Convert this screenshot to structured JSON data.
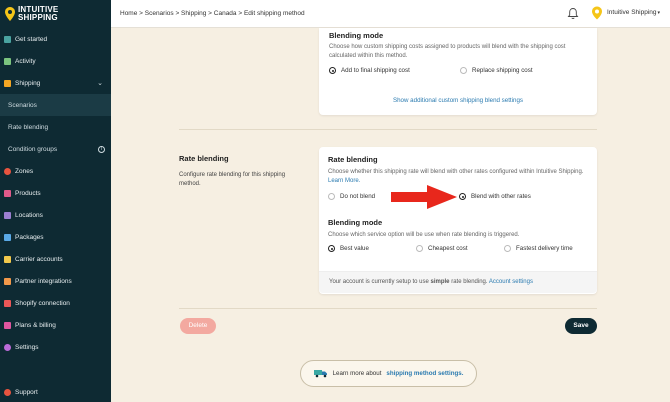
{
  "app": {
    "logo_line1": "INTUITIVE",
    "logo_line2": "SHIPPING"
  },
  "colors": {
    "sidebar_bg": "#0e2a33",
    "page_bg": "#f6efe2",
    "link": "#2b7bb0",
    "delete": "#f3a9a0",
    "arrow": "#e8271c"
  },
  "sidebar": {
    "items": [
      {
        "label": "Get started",
        "icon": "rocket-icon"
      },
      {
        "label": "Activity",
        "icon": "chart-icon"
      },
      {
        "label": "Shipping",
        "icon": "shipping-icon"
      },
      {
        "label": "Scenarios",
        "icon": ""
      },
      {
        "label": "Rate blending",
        "icon": ""
      },
      {
        "label": "Condition groups",
        "icon": ""
      },
      {
        "label": "Zones",
        "icon": "globe-icon"
      },
      {
        "label": "Products",
        "icon": "tag-icon"
      },
      {
        "label": "Locations",
        "icon": "building-icon"
      },
      {
        "label": "Packages",
        "icon": "box-icon"
      },
      {
        "label": "Carrier accounts",
        "icon": "key-icon"
      },
      {
        "label": "Partner integrations",
        "icon": "integration-icon"
      },
      {
        "label": "Shopify connection",
        "icon": "shopify-icon"
      },
      {
        "label": "Plans & billing",
        "icon": "billing-icon"
      },
      {
        "label": "Settings",
        "icon": "gear-icon"
      }
    ],
    "support": "Support"
  },
  "topbar": {
    "breadcrumb": "Home > Scenarios > Shipping > Canada > Edit shipping method",
    "account": "Intuitive Shipping"
  },
  "card1": {
    "title": "Blending mode",
    "desc": "Choose how custom shipping costs assigned to products will blend with the shipping cost calculated within this method.",
    "options": [
      "Add to final shipping cost",
      "Replace shipping cost"
    ],
    "selected": "Add to final shipping cost",
    "link": "Show additional custom shipping blend settings"
  },
  "section": {
    "title": "Rate blending",
    "desc": "Configure rate blending for this shipping method."
  },
  "card2": {
    "title": "Rate blending",
    "desc": "Choose whether this shipping rate will blend with other rates configured within Intuitive Shipping.",
    "learn_more": "Learn More.",
    "options": [
      "Do not blend",
      "Blend with other rates"
    ],
    "selected": "Blend with other rates",
    "mode_title": "Blending mode",
    "mode_desc": "Choose which service option will be use when rate blending is triggered.",
    "mode_options": [
      "Best value",
      "Cheapest cost",
      "Fastest delivery time"
    ],
    "mode_selected": "Best value",
    "footer_pre": "Your account is currently setup to use",
    "footer_bold": "simple",
    "footer_post": "rate blending.",
    "footer_link": "Account settings"
  },
  "actions": {
    "delete": "Delete",
    "save": "Save"
  },
  "learn_more_banner": {
    "pre": "Learn more about",
    "link": "shipping method settings."
  }
}
